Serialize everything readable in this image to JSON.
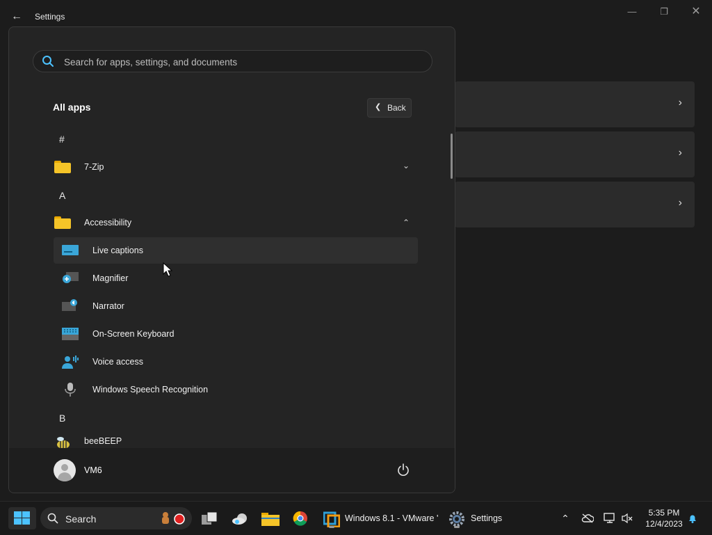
{
  "window": {
    "title": "Settings",
    "controls": [
      "minimize",
      "maximize",
      "close"
    ]
  },
  "start_menu": {
    "search_placeholder": "Search for apps, settings, and documents",
    "all_apps_title": "All apps",
    "back_label": "Back",
    "sections": [
      {
        "letter": "#"
      },
      {
        "letter": "A"
      },
      {
        "letter": "B"
      }
    ],
    "apps": {
      "zip": "7-Zip",
      "accessibility": "Accessibility",
      "live_captions": "Live captions",
      "magnifier": "Magnifier",
      "narrator": "Narrator",
      "osk": "On-Screen Keyboard",
      "voice_access": "Voice access",
      "speech": "Windows Speech Recognition",
      "beebeep": "beeBEEP"
    },
    "user": "VM6"
  },
  "taskbar": {
    "search_label": "Search",
    "vmware_label": "Windows 8.1 - VMware '",
    "settings_label": "Settings",
    "time": "5:35 PM",
    "date": "12/4/2023"
  },
  "colors": {
    "accent": "#4cc2ff",
    "folder": "#f5c428"
  }
}
